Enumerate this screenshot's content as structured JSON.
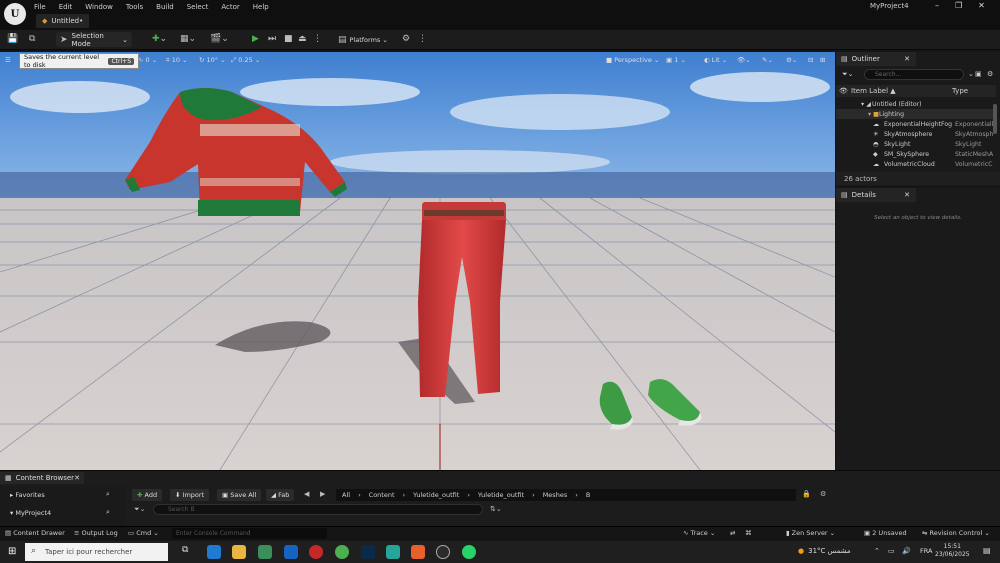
{
  "app": {
    "menu": [
      "File",
      "Edit",
      "Window",
      "Tools",
      "Build",
      "Select",
      "Actor",
      "Help"
    ],
    "document_tab": "Untitled•",
    "project_name": "MyProject4"
  },
  "toolbar": {
    "selection_mode": "Selection Mode",
    "platforms": "Platforms"
  },
  "tooltip": {
    "text": "Saves the current level to disk",
    "shortcut": "Ctrl+S"
  },
  "viewport": {
    "grid_snap": "10",
    "rotation_snap": "10°",
    "scale_snap": "0.25",
    "camera_speed": "1",
    "perspective": "Perspective",
    "view_mode": "Lit",
    "angle_zero": "0"
  },
  "outliner": {
    "title": "Outliner",
    "search_placeholder": "Search...",
    "col_label": "Item Label ▲",
    "col_type": "Type",
    "rows": [
      {
        "label": "Untitled (Editor)",
        "type": ""
      },
      {
        "label": "Lighting",
        "type": ""
      },
      {
        "label": "ExponentialHeightFog",
        "type": "Exponentiall"
      },
      {
        "label": "SkyAtmosphere",
        "type": "SkyAtmosph"
      },
      {
        "label": "SkyLight",
        "type": "SkyLight"
      },
      {
        "label": "SM_SkySphere",
        "type": "StaticMeshA"
      },
      {
        "label": "VolumetricCloud",
        "type": "VolumetricC"
      }
    ],
    "count": "26 actors"
  },
  "details": {
    "title": "Details",
    "empty": "Select an object to view details."
  },
  "content_browser": {
    "tab": "Content Browser",
    "favorites": "Favorites",
    "project": "MyProject4",
    "add": "Add",
    "import": "Import",
    "save_all": "Save All",
    "fab": "Fab",
    "breadcrumb": [
      "All",
      "Content",
      "Yuletide_outfit",
      "Yuletide_outfit",
      "Meshes",
      "B"
    ],
    "search_placeholder": "Search B"
  },
  "statusbar": {
    "content_drawer": "Content Drawer",
    "output_log": "Output Log",
    "cmd": "Cmd",
    "console_placeholder": "Enter Console Command",
    "trace": "Trace",
    "zen_server": "Zen Server",
    "unsaved": "2 Unsaved",
    "revision": "Revision Control"
  },
  "taskbar": {
    "search_placeholder": "Taper ici pour rechercher",
    "weather": "31°C",
    "weather_desc": "مشمس",
    "lang": "FRA",
    "time": "15:51",
    "date": "23/06/2025"
  },
  "colors": {
    "accent_green": "#4caf50",
    "folder": "#d9a441",
    "sweater_red": "#c8352c",
    "sweater_green": "#1f7a3a"
  }
}
